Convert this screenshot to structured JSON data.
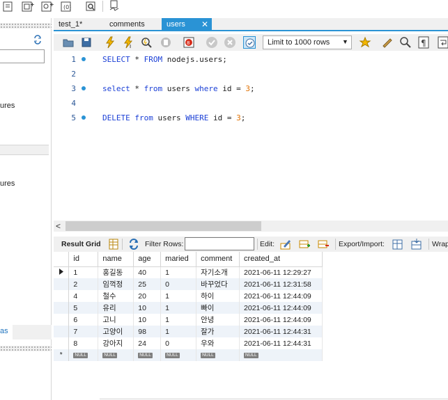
{
  "colors": {
    "accent": "#2a93d5",
    "keyword": "#1a3fd6",
    "number": "#e07000",
    "row_alt": "#eef3f9",
    "toolbar_bg": "#f0f0f0"
  },
  "top_toolbar": {
    "icons": [
      "new-sql-tab-icon",
      "new-schema-icon",
      "new-table-icon",
      "new-function-icon",
      "inspector-icon",
      "reconnect-icon"
    ]
  },
  "left_panel": {
    "text_1": "ures",
    "text_2": "ures",
    "tab_label": "as"
  },
  "tabs": [
    {
      "label": "test_1*"
    },
    {
      "label": "comments"
    },
    {
      "label": "users"
    }
  ],
  "toolbar": {
    "limit_label": "Limit to 1000 rows"
  },
  "editor": {
    "lines": [
      {
        "num": "1",
        "kw1": "SELECT",
        "mid1": " * ",
        "kw2": "FROM",
        "mid2": " nodejs.users;",
        "kw3": "",
        "mid3": "",
        "num_val": ""
      },
      {
        "num": "2"
      },
      {
        "num": "3",
        "kw1": "select",
        "mid1": " * ",
        "kw2": "from",
        "mid2": " users ",
        "kw3": "where",
        "mid3": " id = ",
        "num_val": "3",
        "end": ";"
      },
      {
        "num": "4"
      },
      {
        "num": "5",
        "kw1": "DELETE",
        "mid1": " ",
        "kw2": "from",
        "mid2": " users ",
        "kw3": "WHERE",
        "mid3": " id = ",
        "num_val": "3",
        "end": ";"
      }
    ]
  },
  "result_toolbar": {
    "result_grid": "Result Grid",
    "filter_rows": "Filter Rows:",
    "edit": "Edit:",
    "export_import": "Export/Import:",
    "wrap": "Wrap"
  },
  "grid": {
    "columns": [
      "id",
      "name",
      "age",
      "maried",
      "comment",
      "created_at"
    ],
    "rows": [
      [
        "1",
        "홍길동",
        "40",
        "1",
        "자기소개",
        "2021-06-11 12:29:27"
      ],
      [
        "2",
        "임꺽정",
        "25",
        "0",
        "바꾸었다",
        "2021-06-11 12:31:58"
      ],
      [
        "4",
        "철수",
        "20",
        "1",
        "하이",
        "2021-06-11 12:44:09"
      ],
      [
        "5",
        "유리",
        "10",
        "1",
        "빠이",
        "2021-06-11 12:44:09"
      ],
      [
        "6",
        "고니",
        "10",
        "1",
        "안녕",
        "2021-06-11 12:44:09"
      ],
      [
        "7",
        "고양이",
        "98",
        "1",
        "잘가",
        "2021-06-11 12:44:31"
      ],
      [
        "8",
        "강아지",
        "24",
        "0",
        "우와",
        "2021-06-11 12:44:31"
      ]
    ],
    "null_label": "NULL",
    "new_row_marker": "*"
  }
}
